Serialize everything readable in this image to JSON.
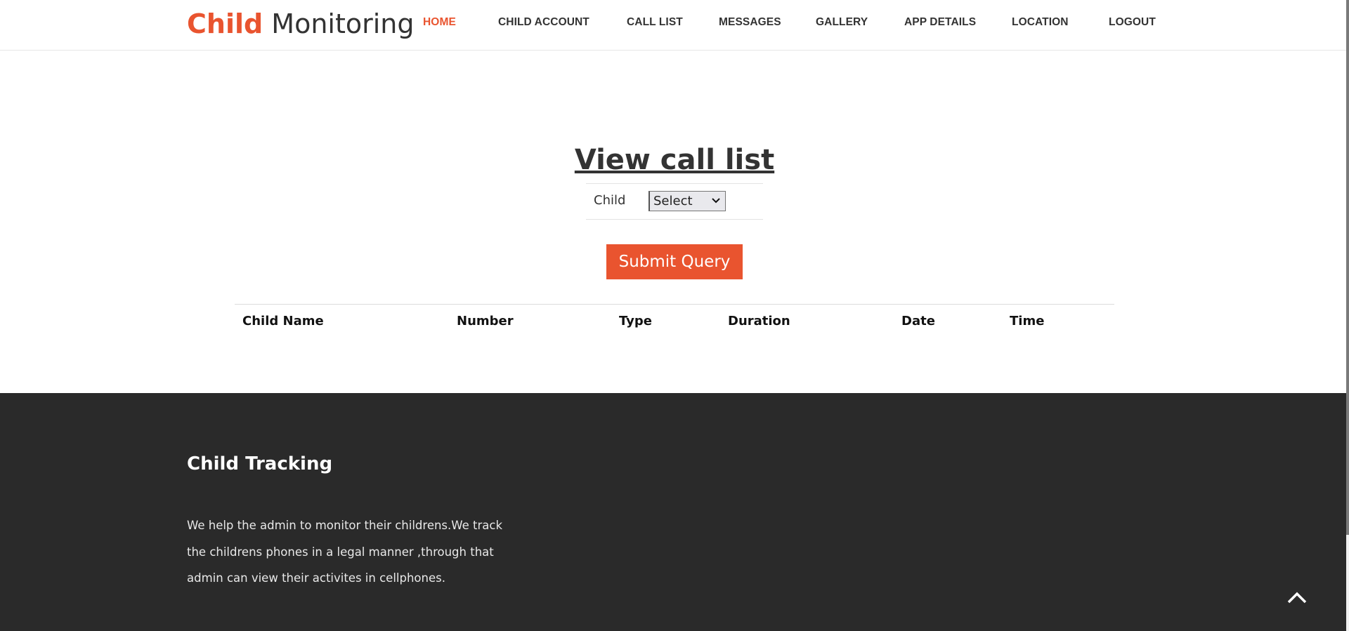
{
  "brand": {
    "accent_word": "Child",
    "rest": "Monitoring",
    "accent_color": "#e9542f"
  },
  "nav": [
    {
      "label": "HOME",
      "active": true
    },
    {
      "label": "CHILD ACCOUNT",
      "active": false
    },
    {
      "label": "CALL LIST",
      "active": false
    },
    {
      "label": "MESSAGES",
      "active": false
    },
    {
      "label": "GALLERY",
      "active": false
    },
    {
      "label": "APP DETAILS",
      "active": false
    },
    {
      "label": "LOCATION",
      "active": false
    },
    {
      "label": "LOGOUT",
      "active": false
    }
  ],
  "main": {
    "title": "View call list",
    "child_label": "Child",
    "child_select": {
      "selected": "Select"
    },
    "submit_label": "Submit Query",
    "table_headers": [
      "Child Name",
      "Number",
      "Type",
      "Duration",
      "Date",
      "Time"
    ]
  },
  "footer": {
    "title": "Child Tracking",
    "text": "We help the admin to monitor their childrens.We track the childrens phones in a legal manner ,through that admin can view their activites in cellphones."
  },
  "icons": {
    "select_caret": "chevron-down-icon",
    "scroll_top": "chevron-up-icon"
  },
  "colors": {
    "accent": "#e9542f",
    "footer_bg": "#2a2a2a",
    "text": "#333333"
  }
}
